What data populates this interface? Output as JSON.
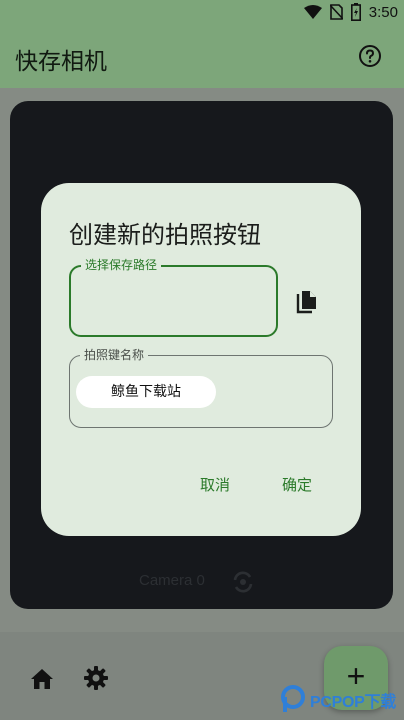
{
  "status_bar": {
    "time": "3:50",
    "icons": [
      "wifi-icon",
      "no-sim-icon",
      "battery-icon"
    ]
  },
  "app_bar": {
    "title": "快存相机",
    "action_icon": "help-icon"
  },
  "camera_card": {
    "camera_label": "Camera 0",
    "switch_icon": "switch-camera-icon"
  },
  "dialog": {
    "title": "创建新的拍照按钮",
    "path_field": {
      "label": "选择保存路径",
      "value": ""
    },
    "copy_icon": "copy-icon",
    "name_field": {
      "label": "拍照键名称",
      "chip": "鲸鱼下载站"
    },
    "cancel_label": "取消",
    "ok_label": "确定"
  },
  "bottom_bar": {
    "icons": [
      "home-icon",
      "settings-icon"
    ],
    "fab_label": "+"
  },
  "watermark": {
    "text": "PCPOP下载"
  },
  "colors": {
    "app_bar": "#7da67a",
    "dialog_bg": "#e0ebde",
    "accent": "#2b7a2a",
    "camera_bg": "#16181c",
    "fab": "#6f9a6b"
  }
}
